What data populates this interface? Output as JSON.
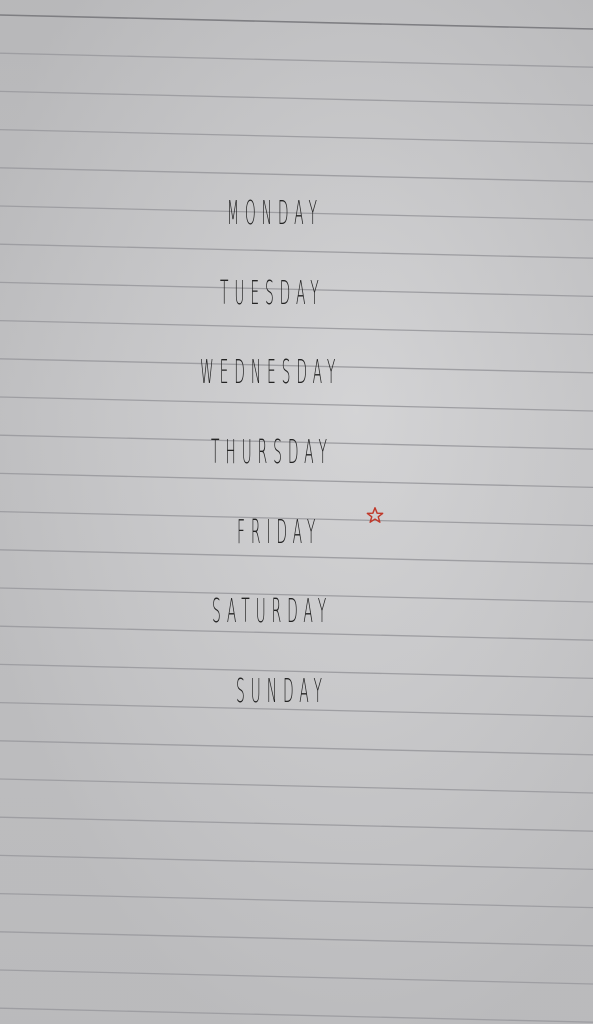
{
  "days": [
    {
      "label": "MONDAY"
    },
    {
      "label": "TUESDAY"
    },
    {
      "label": "WEDNESDAY"
    },
    {
      "label": "THURSDAY"
    },
    {
      "label": "FRIDAY"
    },
    {
      "label": "SATURDAY"
    },
    {
      "label": "SUNDAY"
    }
  ],
  "colors": {
    "paper": "#c6c6c8",
    "rule_line": "#9e9ea2",
    "ink": "#232323",
    "star": "#c0392b"
  },
  "icons": {
    "star": "hand-drawn-star-icon"
  }
}
